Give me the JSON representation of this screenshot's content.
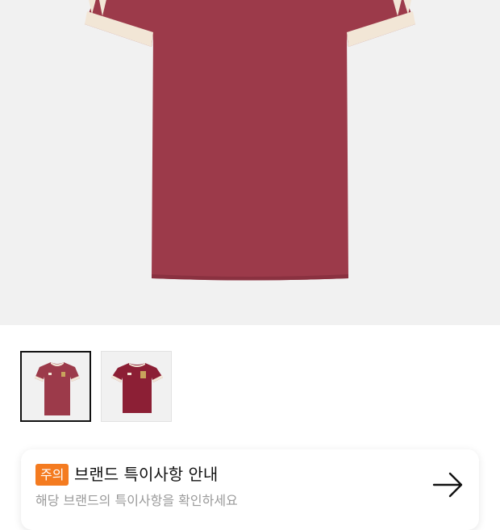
{
  "product": {
    "image_alt": "burgundy jersey with cream cuffs",
    "thumbnails": [
      {
        "name": "thumb-front",
        "selected": true
      },
      {
        "name": "thumb-back",
        "selected": false
      }
    ]
  },
  "notice": {
    "badge": "주의",
    "title": "브랜드 특이사항 안내",
    "subtitle": "해당 브랜드의 특이사항을 확인하세요",
    "arrow_icon": "arrow-right-icon"
  },
  "colors": {
    "shirt": "#9c3a4a",
    "trim": "#f2e6d6",
    "badge": "#f47b20"
  }
}
